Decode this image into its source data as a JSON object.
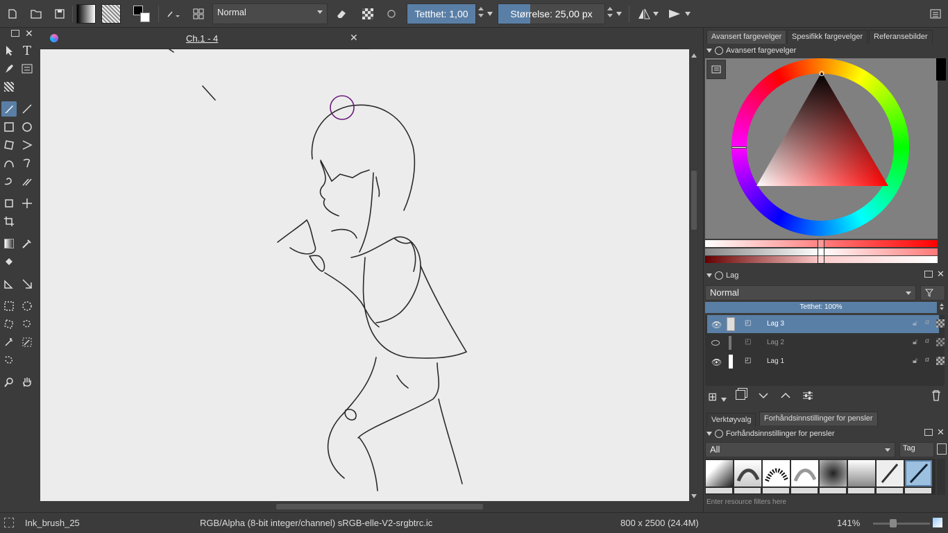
{
  "toolbar": {
    "blend_mode": "Normal",
    "opacity_label": "Tetthet:  1,00",
    "size_label": "Størrelse:  25,00 px"
  },
  "document": {
    "tab_title": "Ch.1 - 4"
  },
  "dock": {
    "tabs": [
      "Avansert fargevelger",
      "Spesifikk fargevelger",
      "Referansebilder"
    ],
    "color_header": "Avansert fargevelger",
    "layers_header": "Lag",
    "layer_blend": "Normal",
    "layer_opacity": "Tetthet:  100%",
    "layers": [
      {
        "name": "Lag 3",
        "selected": true,
        "visible": true
      },
      {
        "name": "Lag 2",
        "selected": false,
        "visible": false
      },
      {
        "name": "Lag 1",
        "selected": false,
        "visible": true
      }
    ],
    "bottom_tabs": [
      "Verktøyvalg",
      "Forhåndsinnstillinger for pensler"
    ],
    "brush_header": "Forhåndsinnstillinger for pensler",
    "brush_filter": "All",
    "tag_label": "Tag",
    "resource_filter_placeholder": "Enter resource filters here"
  },
  "status": {
    "brush_name": "Ink_brush_25",
    "color_model": "RGB/Alpha (8-bit integer/channel)  sRGB-elle-V2-srgbtrc.ic",
    "image_size": "800 x 2500 (24.4M)",
    "zoom": "141%"
  },
  "colors": {
    "accent": "#5a7fa6",
    "bg": "#3b3b3b",
    "canvas": "#ececec"
  }
}
